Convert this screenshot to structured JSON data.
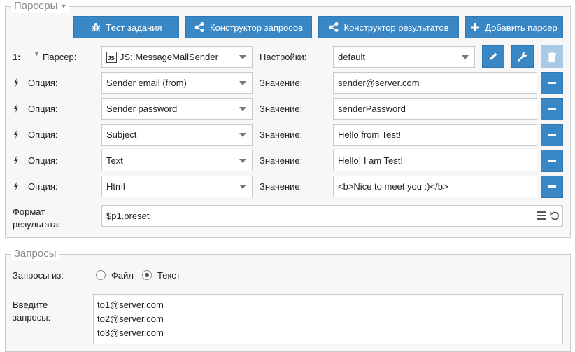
{
  "parsers_section": {
    "title": "Парсеры",
    "toolbar": {
      "test_task": "Тест задания",
      "query_builder": "Конструктор запросов",
      "result_builder": "Конструктор результатов",
      "add_parser": "Добавить парсер"
    },
    "parser_row": {
      "index": "1:",
      "parser_label": "Парсер:",
      "parser_badge": "JS",
      "parser_value": "JS::MessageMailSender",
      "settings_label": "Настройки:",
      "settings_value": "default"
    },
    "option_label": "Опция:",
    "value_label": "Значение:",
    "options": [
      {
        "option": "Sender email (from)",
        "value": "sender@server.com"
      },
      {
        "option": "Sender password",
        "value": "senderPassword"
      },
      {
        "option": "Subject",
        "value": "Hello from Test!"
      },
      {
        "option": "Text",
        "value": "Hello! I am Test!"
      },
      {
        "option": "Html",
        "value": "<b>Nice to meet you :)</b>"
      }
    ],
    "result_format": {
      "label_line1": "Формат",
      "label_line2": "результата:",
      "value": "$p1.preset"
    }
  },
  "queries_section": {
    "title": "Запросы",
    "source_label": "Запросы из:",
    "source_options": [
      {
        "label": "Файл",
        "selected": false
      },
      {
        "label": "Текст",
        "selected": true
      }
    ],
    "input_label_line1": "Введите",
    "input_label_line2": "запросы:",
    "queries": [
      "to1@server.com",
      "to2@server.com",
      "to3@server.com"
    ]
  },
  "colors": {
    "accent": "#3a87c6",
    "accent_disabled": "#a9c9e4",
    "panel_bg": "#f7f7f7",
    "border": "#c8c8c8"
  },
  "icons": {
    "test_task": "bug-icon",
    "query_builder": "share-icon",
    "result_builder": "share-icon",
    "add_parser": "plus-icon",
    "edit": "pencil-icon",
    "settings": "wrench-icon",
    "delete": "trash-icon",
    "option_bullet": "bolt-icon",
    "remove_option": "minus-icon",
    "format_menu": "hamburger-icon",
    "format_reset": "undo-icon"
  }
}
